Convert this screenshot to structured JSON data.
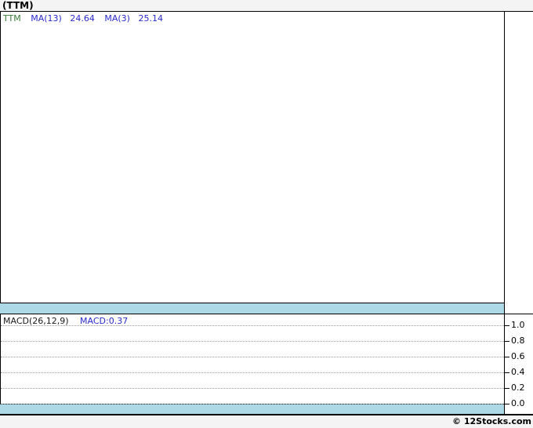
{
  "header": {
    "title": "(TTM)"
  },
  "main_chart": {
    "legend": {
      "symbol": "TTM",
      "ma13_label": "MA(13)",
      "ma13_value": "24.64",
      "ma3_label": "MA(3)",
      "ma3_value": "25.14"
    }
  },
  "macd_panel": {
    "indicator_label": "MACD(26,12,9)",
    "indicator_value": "MACD:0.37",
    "axis_ticks": [
      "1.0",
      "0.8",
      "0.6",
      "0.4",
      "0.2",
      "0.0"
    ]
  },
  "footer": {
    "credit": "© 12Stocks.com"
  },
  "colors": {
    "band_blue": "#add8e6",
    "legend_green": "#3a7a3a",
    "indicator_blue": "#2a2ac8",
    "grid_gray": "#999999",
    "chrome": "#f4f4f4"
  },
  "chart_data": [
    {
      "type": "line",
      "title": "(TTM) price panel",
      "series": [
        {
          "name": "TTM",
          "values": []
        },
        {
          "name": "MA(13)",
          "last_value": 24.64,
          "values": []
        },
        {
          "name": "MA(3)",
          "last_value": 25.14,
          "values": []
        }
      ],
      "legend_position": "top-left",
      "grid": false,
      "note": "plot area is blank in the screenshot; only legend readouts are visible"
    },
    {
      "type": "line",
      "title": "MACD(26,12,9)",
      "series": [
        {
          "name": "MACD",
          "last_value": 0.37,
          "values": []
        }
      ],
      "ylim": [
        0.0,
        1.0
      ],
      "yticks": [
        1.0,
        0.8,
        0.6,
        0.4,
        0.2,
        0.0
      ],
      "grid": true,
      "legend_position": "top-left",
      "note": "no visible MACD curve; dotted gridlines and zero-line band only"
    }
  ]
}
